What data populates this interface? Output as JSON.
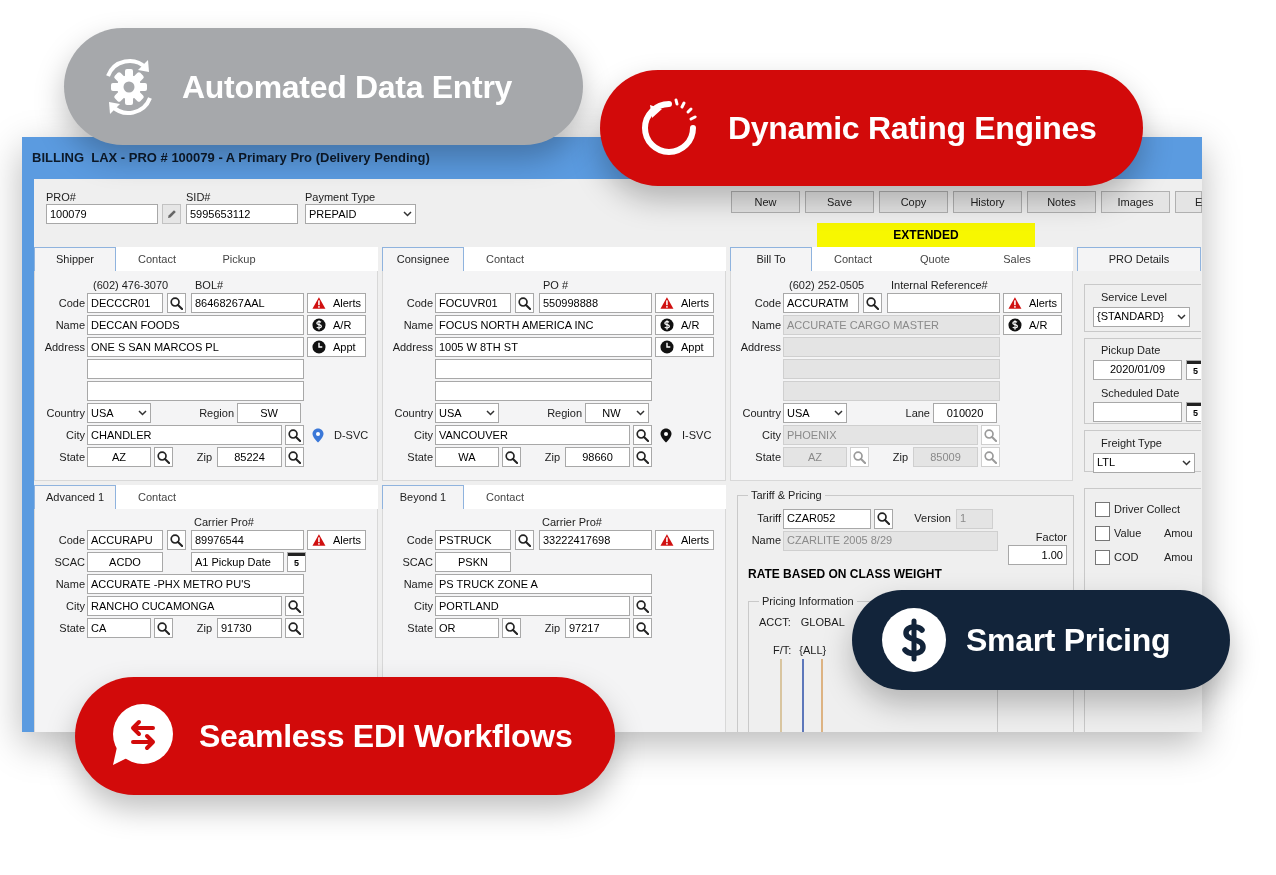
{
  "window": {
    "title": "BILLING  LAX - PRO # 100079 - A Primary Pro (Delivery Pending)"
  },
  "header_fields": [
    {
      "label": "PRO#",
      "value": "100079",
      "kind": "editable"
    },
    {
      "label": "SID#",
      "value": "5995653112",
      "kind": "text"
    },
    {
      "label": "Payment Type",
      "value": "PREPAID",
      "kind": "select"
    }
  ],
  "toolbar": [
    "New",
    "Save",
    "Copy",
    "History",
    "Notes",
    "Images",
    "E"
  ],
  "status_banner": "EXTENDED",
  "top_panels": [
    {
      "tabs": [
        {
          "label": "Shipper",
          "selected": true
        },
        {
          "label": "Contact",
          "selected": false
        },
        {
          "label": "Pickup",
          "selected": false
        }
      ],
      "phone": "(602) 476-3070",
      "locked": false,
      "code": {
        "label": "Code",
        "value": "DECCCR01"
      },
      "ref": {
        "label": "BOL#",
        "value": "86468267AAL"
      },
      "name": {
        "label": "Name",
        "value": "DECCAN FOODS"
      },
      "address": {
        "label": "Address",
        "lines": [
          "ONE S SAN MARCOS PL"
        ]
      },
      "country": {
        "label": "Country",
        "value": "USA"
      },
      "region": {
        "label": "Region",
        "value": "SW",
        "dropdown": false
      },
      "city": {
        "label": "City",
        "value": "CHANDLER"
      },
      "service": {
        "label": "D-SVC",
        "color": "#3b78d8"
      },
      "state": {
        "label": "State",
        "value": "AZ"
      },
      "zip": {
        "label": "Zip",
        "value": "85224"
      },
      "actions": [
        {
          "label": "Alerts",
          "kind": "alert"
        },
        {
          "label": "A/R",
          "kind": "money"
        },
        {
          "label": "Appt",
          "kind": "clock"
        }
      ]
    },
    {
      "tabs": [
        {
          "label": "Consignee",
          "selected": true
        },
        {
          "label": "Contact",
          "selected": false
        }
      ],
      "locked": false,
      "code": {
        "label": "Code",
        "value": "FOCUVR01"
      },
      "ref": {
        "label": "PO #",
        "value": "550998888"
      },
      "name": {
        "label": "Name",
        "value": "FOCUS NORTH AMERICA INC"
      },
      "address": {
        "label": "Address",
        "lines": [
          "1005 W 8TH ST"
        ]
      },
      "country": {
        "label": "Country",
        "value": "USA"
      },
      "region": {
        "label": "Region",
        "value": "NW",
        "dropdown": true
      },
      "city": {
        "label": "City",
        "value": "VANCOUVER"
      },
      "service": {
        "label": "I-SVC",
        "color": "#111111"
      },
      "state": {
        "label": "State",
        "value": "WA"
      },
      "zip": {
        "label": "Zip",
        "value": "98660"
      },
      "actions": [
        {
          "label": "Alerts",
          "kind": "alert"
        },
        {
          "label": "A/R",
          "kind": "money"
        },
        {
          "label": "Appt",
          "kind": "clock"
        }
      ]
    },
    {
      "tabs": [
        {
          "label": "Bill To",
          "selected": true
        },
        {
          "label": "Contact",
          "selected": false
        },
        {
          "label": "Quote",
          "selected": false
        },
        {
          "label": "Sales",
          "selected": false
        }
      ],
      "phone": "(602) 252-0505",
      "locked": true,
      "code": {
        "label": "Code",
        "value": "ACCURATM"
      },
      "ref": {
        "label": "Internal Reference#"
      },
      "name": {
        "label": "Name",
        "value": "ACCURATE CARGO MASTER"
      },
      "address": {
        "label": "Address"
      },
      "country": {
        "label": "Country",
        "value": "USA"
      },
      "region": {
        "label": "Lane",
        "value": "010020",
        "dropdown": false
      },
      "city": {
        "label": "City",
        "value": "PHOENIX"
      },
      "state": {
        "label": "State",
        "value": "AZ"
      },
      "zip": {
        "label": "Zip",
        "value": "85009"
      },
      "actions": [
        {
          "label": "Alerts",
          "kind": "alert"
        },
        {
          "label": "A/R",
          "kind": "money"
        }
      ]
    }
  ],
  "lower_panels": [
    {
      "tabs": [
        {
          "label": "Advanced 1",
          "selected": true
        },
        {
          "label": "Contact",
          "selected": false
        }
      ],
      "code": {
        "label": "Code",
        "value": "ACCURAPU"
      },
      "ref": {
        "label": "Carrier Pro#",
        "value": "89976544"
      },
      "action": {
        "label": "Alerts",
        "kind": "alert"
      },
      "scac": {
        "label": "SCAC",
        "value": "ACDO"
      },
      "pickup_date": {
        "placeholder": "A1 Pickup Date",
        "calendar_day": "5"
      },
      "name": {
        "label": "Name",
        "value": "ACCURATE -PHX  METRO PU'S"
      },
      "city": {
        "label": "City",
        "value": "RANCHO CUCAMONGA"
      },
      "state": {
        "label": "State",
        "value": "CA"
      },
      "zip": {
        "label": "Zip",
        "value": "91730"
      }
    },
    {
      "tabs": [
        {
          "label": "Beyond 1",
          "selected": true
        },
        {
          "label": "Contact",
          "selected": false
        }
      ],
      "code": {
        "label": "Code",
        "value": "PSTRUCK"
      },
      "ref": {
        "label": "Carrier Pro#",
        "value": "33222417698"
      },
      "action": {
        "label": "Alerts",
        "kind": "alert"
      },
      "scac": {
        "label": "SCAC",
        "value": "PSKN"
      },
      "name": {
        "label": "Name",
        "value": "PS TRUCK ZONE A"
      },
      "city": {
        "label": "City",
        "value": "PORTLAND"
      },
      "state": {
        "label": "State",
        "value": "OR"
      },
      "zip": {
        "label": "Zip",
        "value": "97217"
      }
    }
  ],
  "tariff": {
    "title": "Tariff & Pricing",
    "tariff": {
      "label": "Tariff",
      "value": "CZAR052"
    },
    "version": {
      "label": "Version",
      "value": "1"
    },
    "name": {
      "label": "Name",
      "value": "CZARLITE 2005 8/29"
    },
    "factor": {
      "label": "Factor",
      "value": "1.00"
    },
    "rate_basis": "RATE BASED ON CLASS WEIGHT",
    "pricing_info": {
      "title": "Pricing Information",
      "acct": {
        "label": "ACCT:",
        "value": "GLOBAL"
      },
      "ft": {
        "label": "F/T:",
        "value": "{ALL}"
      }
    }
  },
  "pro_details": {
    "tabs": [
      {
        "label": "PRO Details",
        "selected": true
      }
    ],
    "service_level": {
      "label": "Service Level",
      "value": "{STANDARD}"
    },
    "pickup_date": {
      "label": "Pickup Date",
      "value": "2020/01/09",
      "calendar_day": "5"
    },
    "scheduled_date": {
      "label": "Scheduled Date",
      "calendar_day": "5"
    },
    "freight_type": {
      "label": "Freight Type",
      "value": "LTL"
    },
    "options": [
      {
        "label": "Driver Collect",
        "checked": false
      },
      {
        "label": "Value",
        "checked": false,
        "extra": "Amou"
      },
      {
        "label": "COD",
        "checked": false,
        "extra": "Amou"
      }
    ]
  },
  "features": [
    {
      "label": "Automated Data Entry",
      "kind": "gear",
      "color": "#a6a8ab"
    },
    {
      "label": "Dynamic Rating Engines",
      "kind": "rating",
      "color": "#d20a0a"
    },
    {
      "label": "Seamless EDI Workflows",
      "kind": "exchange",
      "color": "#d20a0a"
    },
    {
      "label": "Smart Pricing",
      "kind": "dollar",
      "color": "#12243a"
    }
  ]
}
